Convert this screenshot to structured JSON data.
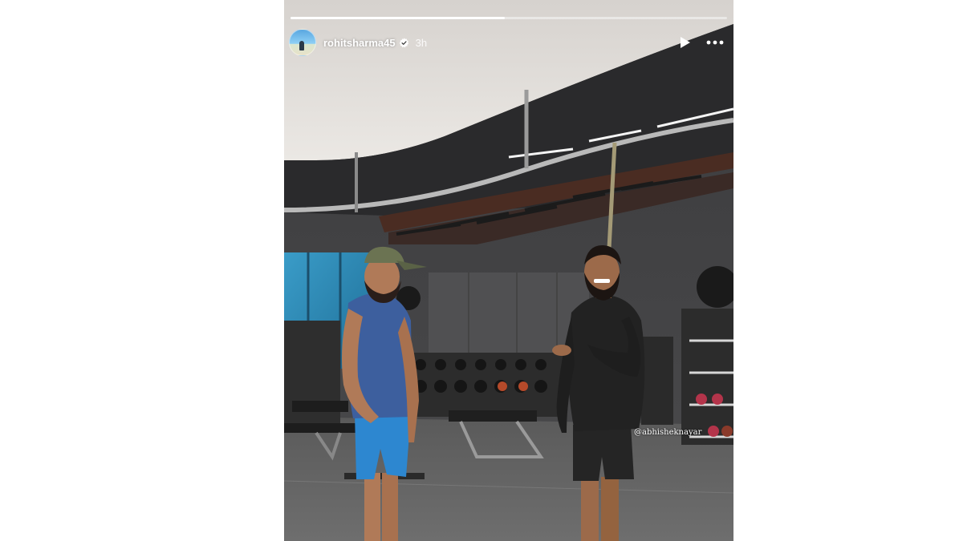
{
  "story": {
    "username": "rohitsharma45",
    "time": "3h",
    "progress": 0.49,
    "mention_tag": "@abhisheknayar"
  },
  "icons": {
    "verified": "verified-badge-icon",
    "play": "play-icon",
    "more": "more-options-icon"
  },
  "colors": {
    "accent": "#ffffff",
    "verified_badge": "#ffffff",
    "left_shirt": "#3d5f9e",
    "left_shorts": "#2d87d0",
    "right_hoodie": "#222222"
  }
}
